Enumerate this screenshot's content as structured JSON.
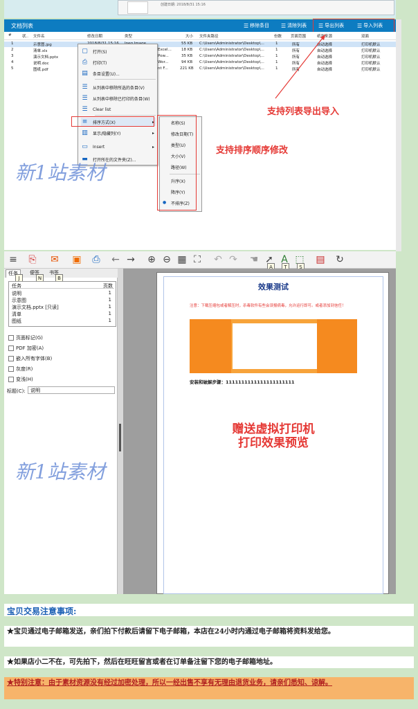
{
  "top": {
    "date": "创建日期: 2018/8/31 15:16"
  },
  "file_list": {
    "title": "文档列表",
    "buttons": {
      "remove": "移除条目",
      "clear": "清除列表",
      "export": "导出列表",
      "import": "导入列表"
    },
    "columns": [
      "#",
      "状..",
      "文件名",
      "修改日期",
      "类型",
      "大小",
      "文件夹路径",
      "份数",
      "页面范围",
      "纸张来源",
      "双面"
    ],
    "rows": [
      {
        "n": "1",
        "name": "示意图.jpg",
        "date": "2018/8/31 15:16",
        "type": "Jpeg Image",
        "size": "55 KB",
        "path": "C:\\Users\\Administrator\\Desktop\\...",
        "copies": "1",
        "range": "所有",
        "source": "自动选择",
        "duplex": "打印机默认"
      },
      {
        "n": "2",
        "name": "清单.xls",
        "date": "",
        "type": "Excel...",
        "size": "18 KB",
        "path": "C:\\Users\\Administrator\\Desktop\\...",
        "copies": "1",
        "range": "所有",
        "source": "自动选择",
        "duplex": "打印机默认"
      },
      {
        "n": "3",
        "name": "演示文档.pptx",
        "date": "",
        "type": "Pow...",
        "size": "35 KB",
        "path": "C:\\Users\\Administrator\\Desktop\\...",
        "copies": "1",
        "range": "所有",
        "source": "自动选择",
        "duplex": "打印机默认"
      },
      {
        "n": "4",
        "name": "说明.doc",
        "date": "",
        "type": "Wor...",
        "size": "94 KB",
        "path": "C:\\Users\\Administrator\\Desktop\\...",
        "copies": "1",
        "range": "所有",
        "source": "自动选择",
        "duplex": "打印机默认"
      },
      {
        "n": "5",
        "name": "图纸.pdf",
        "date": "",
        "type": "nt F...",
        "size": "221 KB",
        "path": "C:\\Users\\Administrator\\Desktop\\...",
        "copies": "1",
        "range": "所有",
        "source": "自动选择",
        "duplex": "打印机默认"
      }
    ]
  },
  "context_menu": {
    "items": [
      "打开(S)",
      "打印(T)",
      "条目设置(U)...",
      "从列表中移除所选的条目(V)",
      "从列表中移除已打印的条目(W)",
      "Clear list",
      "排序方式(X)",
      "显示/隐藏列(Y)",
      "Insert",
      "打开所在的文件夹(Z)..."
    ]
  },
  "sort_submenu": {
    "items": [
      "名称(S)",
      "修改日期(T)",
      "类型(U)",
      "大小(V)",
      "路径(W)",
      "升序(X)",
      "降序(Y)",
      "不排序(Z)"
    ]
  },
  "annotations": {
    "export_import": "支持列表导出导入",
    "sort": "支持排序顺序修改",
    "watermark": "新1站素材"
  },
  "toolbar": {
    "badges": [
      "A",
      "T",
      "S"
    ]
  },
  "left_panel": {
    "tabs": [
      "任务",
      "便签",
      "书签"
    ],
    "tab_keys": [
      "J",
      "N",
      "B"
    ],
    "task_header": {
      "name": "任务",
      "pages": "页数"
    },
    "tasks": [
      {
        "name": "说明",
        "pages": "1"
      },
      {
        "name": "示意图",
        "pages": "1"
      },
      {
        "name": "演示文档.pptx [只读]",
        "pages": "1"
      },
      {
        "name": "清单",
        "pages": "1"
      },
      {
        "name": "图纸",
        "pages": "1"
      }
    ],
    "options": [
      "页面标记(G)",
      "PDF 加密(A)",
      "嵌入所有字体(B)",
      "灰度(R)",
      "变浅(H)"
    ],
    "title_label": "标题(C):",
    "title_value": "说明"
  },
  "preview": {
    "heading": "效果测试",
    "notice": "注意：下载压缩包或者解压时，杀毒软件有些会误报病毒，允许运行即可。或者添加到信任！",
    "steps": "安装和破解步骤：1111111111111111111111",
    "promo_line1": "赠送虚拟打印机",
    "promo_line2": "打印效果预览"
  },
  "notes": {
    "heading": "宝贝交易注意事项:",
    "n1": "★宝贝通过电子邮箱发送，亲们拍下付款后请留下电子邮箱，本店在24小时内通过电子邮箱将资料发给您。",
    "n2": "★如果店小二不在，可先拍下，然后在旺旺留言或者在订单备注留下您的电子邮箱地址。",
    "n3": "★特别注意：由于素材资源没有经过加密处理，所以一经出售不享有无理由退货业务，请亲们悉知、谅解。"
  },
  "colors": {
    "titlebar": "#0d7cc1",
    "annotation_red": "#e53935",
    "watermark": "#6d8fd8",
    "warn_bg": "#f7b46a"
  }
}
